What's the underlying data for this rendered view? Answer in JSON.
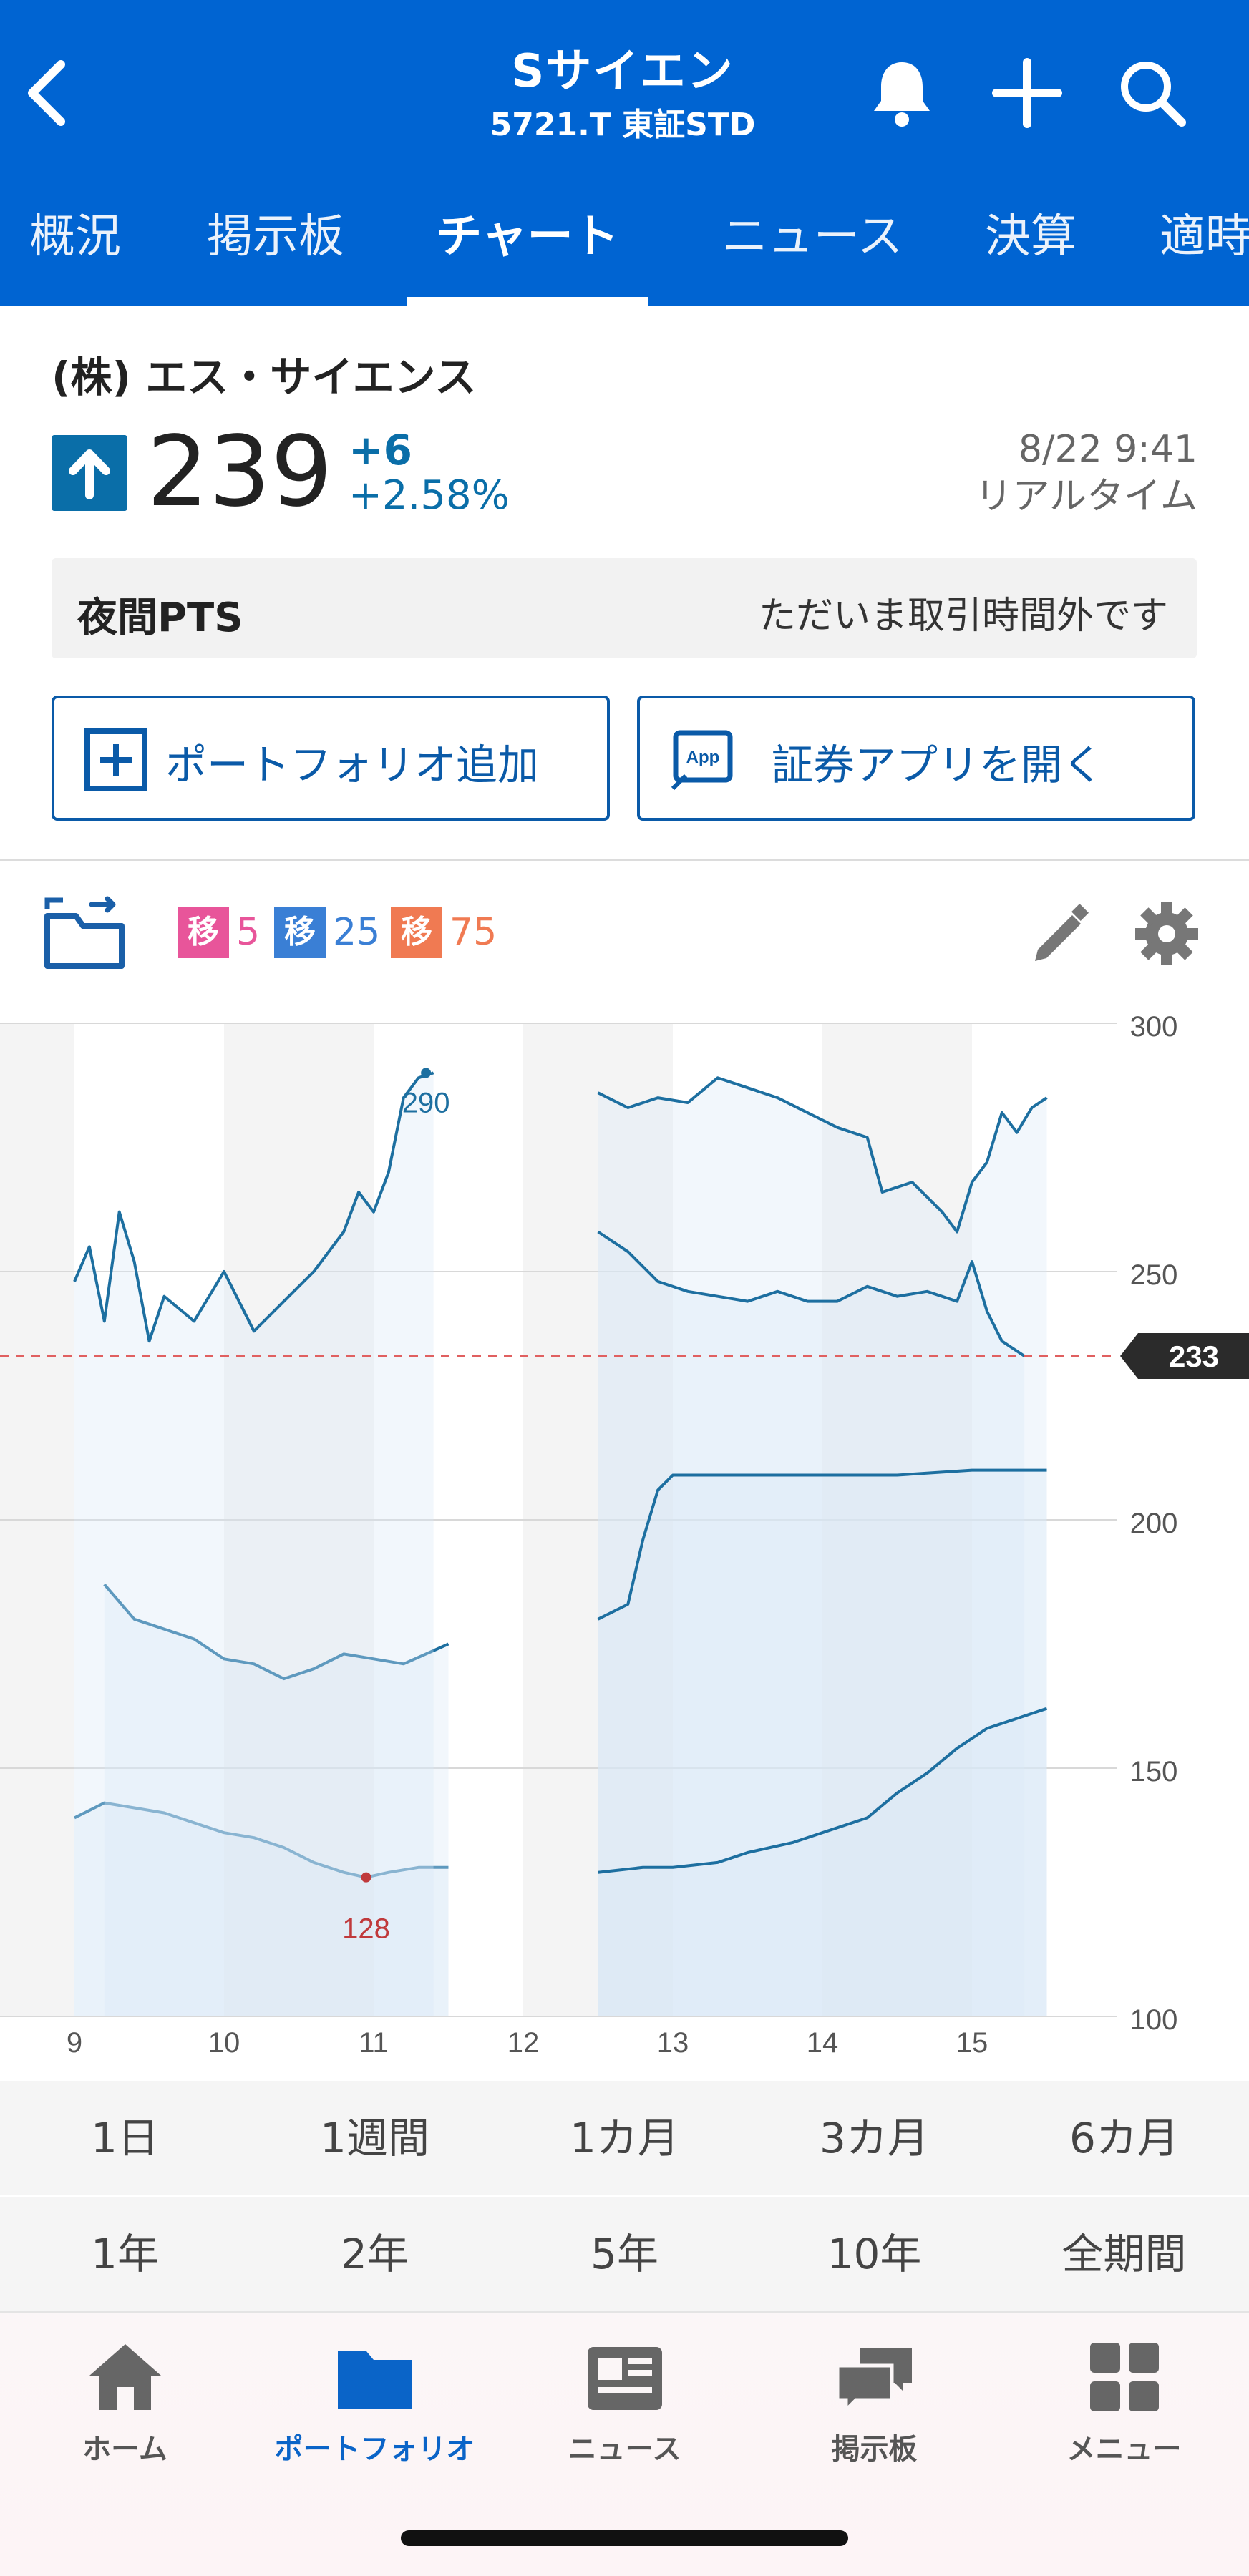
{
  "header": {
    "title": "Sサイエン",
    "subtitle": "5721.T 東証STD",
    "icons": [
      "chevron-left-icon",
      "bell-icon",
      "plus-icon",
      "search-icon"
    ]
  },
  "tabs": [
    {
      "label": "概況",
      "active": false
    },
    {
      "label": "掲示板",
      "active": false
    },
    {
      "label": "チャート",
      "active": true
    },
    {
      "label": "ニュース",
      "active": false
    },
    {
      "label": "決算",
      "active": false
    },
    {
      "label": "適時",
      "active": false
    }
  ],
  "stock": {
    "company": "(株) エス・サイエンス",
    "price": "239",
    "change": "+6",
    "change_pct": "+2.58%",
    "datetime": "8/22 9:41",
    "realtime_label": "リアルタイム"
  },
  "pts": {
    "label": "夜間PTS",
    "status": "ただいま取引時間外です"
  },
  "actions": {
    "portfolio_add": "ポートフォリオ追加",
    "open_app": "証券アプリを開く",
    "app_icon_text": "App"
  },
  "chart_toolbar": {
    "moving_averages": [
      {
        "label": "移",
        "period": "5",
        "color": "#e8559a"
      },
      {
        "label": "移",
        "period": "25",
        "color": "#3a7fd5"
      },
      {
        "label": "移",
        "period": "75",
        "color": "#f07a52"
      }
    ]
  },
  "chart_data": {
    "type": "line",
    "x_ticks": [
      "9",
      "10",
      "11",
      "12",
      "13",
      "14",
      "15"
    ],
    "y_ticks": [
      "300",
      "250",
      "200",
      "150",
      "100"
    ],
    "ylim": [
      100,
      300
    ],
    "current_price_label": "233",
    "current_price": 233,
    "annotations": [
      {
        "label": "290",
        "x": 11.35,
        "y": 290
      },
      {
        "label": "128",
        "x": 10.95,
        "y": 128
      }
    ],
    "series": [
      {
        "segments": [
          {
            "points": [
              [
                9.0,
                140
              ],
              [
                9.2,
                143
              ],
              [
                9.4,
                142
              ],
              [
                9.6,
                141
              ],
              [
                9.8,
                139
              ],
              [
                10.0,
                137
              ],
              [
                10.2,
                136
              ],
              [
                10.4,
                134
              ],
              [
                10.6,
                131
              ],
              [
                10.8,
                129
              ],
              [
                10.95,
                128
              ],
              [
                11.1,
                129
              ],
              [
                11.3,
                130
              ],
              [
                11.5,
                130
              ]
            ]
          },
          {
            "points": [
              [
                9.2,
                187
              ],
              [
                9.4,
                180
              ],
              [
                9.6,
                178
              ],
              [
                9.8,
                176
              ],
              [
                10.0,
                172
              ],
              [
                10.2,
                171
              ],
              [
                10.4,
                168
              ],
              [
                10.6,
                170
              ],
              [
                10.8,
                173
              ],
              [
                11.0,
                172
              ],
              [
                11.2,
                171
              ],
              [
                11.5,
                175
              ]
            ]
          },
          {
            "points": [
              [
                9.0,
                248
              ],
              [
                9.1,
                255
              ],
              [
                9.2,
                240
              ],
              [
                9.3,
                262
              ],
              [
                9.4,
                252
              ],
              [
                9.5,
                236
              ],
              [
                9.6,
                245
              ],
              [
                9.8,
                240
              ],
              [
                10.0,
                250
              ],
              [
                10.2,
                238
              ],
              [
                10.4,
                244
              ],
              [
                10.6,
                250
              ],
              [
                10.8,
                258
              ],
              [
                10.9,
                266
              ],
              [
                11.0,
                262
              ],
              [
                11.1,
                270
              ],
              [
                11.2,
                285
              ],
              [
                11.3,
                289
              ],
              [
                11.4,
                290
              ]
            ]
          },
          {
            "points": [
              [
                12.5,
                286
              ],
              [
                12.7,
                283
              ],
              [
                12.9,
                285
              ],
              [
                13.1,
                284
              ],
              [
                13.3,
                289
              ],
              [
                13.5,
                287
              ],
              [
                13.7,
                285
              ],
              [
                13.9,
                282
              ],
              [
                14.1,
                279
              ],
              [
                14.3,
                277
              ],
              [
                14.4,
                266
              ],
              [
                14.6,
                268
              ],
              [
                14.8,
                262
              ],
              [
                14.9,
                258
              ],
              [
                15.0,
                268
              ],
              [
                15.1,
                272
              ],
              [
                15.2,
                282
              ],
              [
                15.3,
                278
              ],
              [
                15.4,
                283
              ],
              [
                15.5,
                285
              ]
            ]
          },
          {
            "points": [
              [
                12.5,
                258
              ],
              [
                12.7,
                254
              ],
              [
                12.9,
                248
              ],
              [
                13.1,
                246
              ],
              [
                13.3,
                245
              ],
              [
                13.5,
                244
              ],
              [
                13.7,
                246
              ],
              [
                13.9,
                244
              ],
              [
                14.1,
                244
              ],
              [
                14.3,
                247
              ],
              [
                14.5,
                245
              ],
              [
                14.7,
                246
              ],
              [
                14.9,
                244
              ],
              [
                15.0,
                252
              ],
              [
                15.1,
                242
              ],
              [
                15.2,
                236
              ],
              [
                15.35,
                233
              ]
            ]
          },
          {
            "points": [
              [
                12.5,
                180
              ],
              [
                12.7,
                183
              ],
              [
                12.8,
                196
              ],
              [
                12.9,
                206
              ],
              [
                13.0,
                209
              ],
              [
                13.5,
                209
              ],
              [
                14.0,
                209
              ],
              [
                14.5,
                209
              ],
              [
                15.0,
                210
              ],
              [
                15.5,
                210
              ]
            ]
          },
          {
            "points": [
              [
                12.5,
                129
              ],
              [
                12.8,
                130
              ],
              [
                13.0,
                130
              ],
              [
                13.3,
                131
              ],
              [
                13.5,
                133
              ],
              [
                13.8,
                135
              ],
              [
                14.0,
                137
              ],
              [
                14.3,
                140
              ],
              [
                14.5,
                145
              ],
              [
                14.7,
                149
              ],
              [
                14.9,
                154
              ],
              [
                15.1,
                158
              ],
              [
                15.3,
                160
              ],
              [
                15.5,
                162
              ]
            ]
          }
        ]
      }
    ]
  },
  "periods_row1": [
    {
      "label": "1日",
      "active": true
    },
    {
      "label": "1週間",
      "active": false
    },
    {
      "label": "1カ月",
      "active": false
    },
    {
      "label": "3カ月",
      "active": false
    },
    {
      "label": "6カ月",
      "active": false
    }
  ],
  "periods_row2": [
    {
      "label": "1年",
      "active": false
    },
    {
      "label": "2年",
      "active": false
    },
    {
      "label": "5年",
      "active": false
    },
    {
      "label": "10年",
      "active": false
    },
    {
      "label": "全期間",
      "active": false
    }
  ],
  "bottom_nav": [
    {
      "label": "ホーム",
      "icon": "home-icon",
      "active": false
    },
    {
      "label": "ポートフォリオ",
      "icon": "folder-icon",
      "active": true
    },
    {
      "label": "ニュース",
      "icon": "newspaper-icon",
      "active": false
    },
    {
      "label": "掲示板",
      "icon": "chat-bubbles-icon",
      "active": false
    },
    {
      "label": "メニュー",
      "icon": "grid-icon",
      "active": false
    }
  ]
}
